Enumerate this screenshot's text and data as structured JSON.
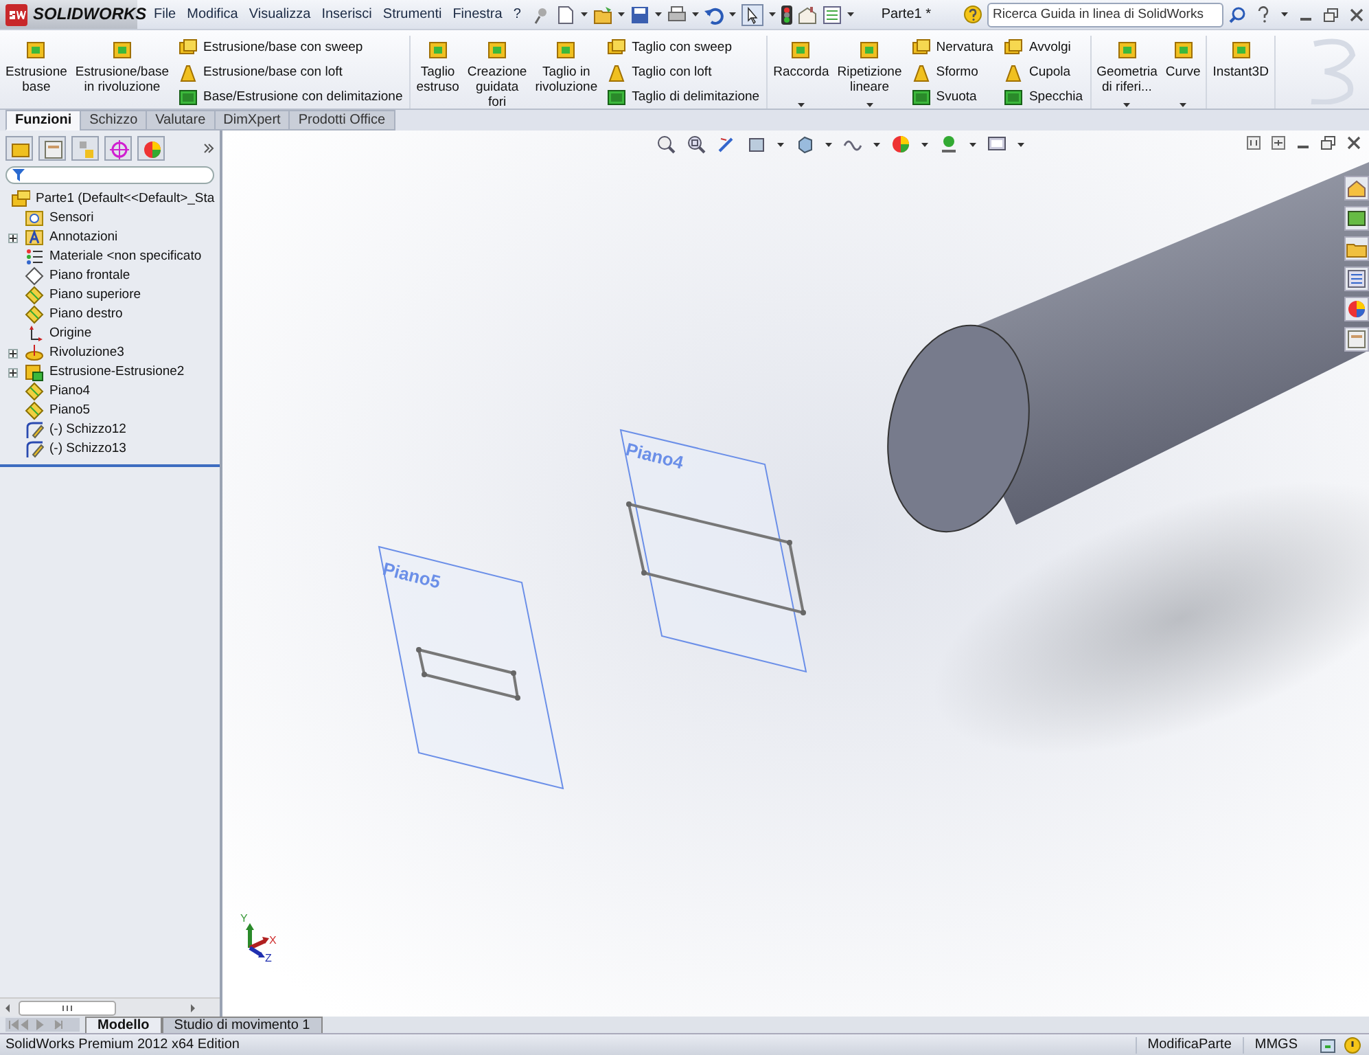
{
  "app": {
    "logo": "SOLIDWORKS",
    "document_title": "Parte1 *"
  },
  "menu": [
    "File",
    "Modifica",
    "Visualizza",
    "Inserisci",
    "Strumenti",
    "Finestra",
    "?"
  ],
  "search": {
    "placeholder": "Ricerca Guida in linea di SolidWorks"
  },
  "ribbon": {
    "groups": [
      {
        "columns": [
          {
            "kind": "large",
            "lines": [
              "Estrusione",
              "base"
            ],
            "dropdown": false
          },
          {
            "kind": "large",
            "lines": [
              "Estrusione/base",
              "in rivoluzione"
            ],
            "dropdown": false
          },
          {
            "kind": "stack",
            "items": [
              "Estrusione/base con sweep",
              "Estrusione/base con loft",
              "Base/Estrusione con delimitazione"
            ]
          }
        ]
      },
      {
        "columns": [
          {
            "kind": "large",
            "lines": [
              "Taglio",
              "estruso"
            ],
            "dropdown": false
          },
          {
            "kind": "large",
            "lines": [
              "Creazione",
              "guidata",
              "fori"
            ],
            "dropdown": false
          },
          {
            "kind": "large",
            "lines": [
              "Taglio in",
              "rivoluzione"
            ],
            "dropdown": false
          },
          {
            "kind": "stack",
            "items": [
              "Taglio con sweep",
              "Taglio con loft",
              "Taglio di delimitazione"
            ]
          }
        ]
      },
      {
        "columns": [
          {
            "kind": "large",
            "lines": [
              "Raccorda"
            ],
            "dropdown": true
          },
          {
            "kind": "large",
            "lines": [
              "Ripetizione",
              "lineare"
            ],
            "dropdown": true
          },
          {
            "kind": "stack",
            "items": [
              "Nervatura",
              "Sformo",
              "Svuota"
            ]
          },
          {
            "kind": "stack",
            "items": [
              "Avvolgi",
              "Cupola",
              "Specchia"
            ]
          }
        ]
      },
      {
        "columns": [
          {
            "kind": "large",
            "lines": [
              "Geometria",
              "di riferi..."
            ],
            "dropdown": true
          },
          {
            "kind": "large",
            "lines": [
              "Curve"
            ],
            "dropdown": true
          }
        ]
      },
      {
        "columns": [
          {
            "kind": "large",
            "lines": [
              "Instant3D"
            ],
            "dropdown": false
          }
        ]
      }
    ]
  },
  "command_tabs": [
    {
      "label": "Funzioni",
      "selected": true
    },
    {
      "label": "Schizzo",
      "selected": false
    },
    {
      "label": "Valutare",
      "selected": false
    },
    {
      "label": "DimXpert",
      "selected": false
    },
    {
      "label": "Prodotti Office",
      "selected": false
    }
  ],
  "feature_tree": {
    "root": {
      "label": "Parte1  (Default<<Default>_Sta",
      "kind": "part",
      "children": [
        {
          "label": "Sensori",
          "kind": "sensor"
        },
        {
          "label": "Annotazioni",
          "kind": "annotation",
          "expanded": false
        },
        {
          "label": "Materiale <non specificato",
          "kind": "material"
        },
        {
          "label": "Piano frontale",
          "kind": "plane-outline"
        },
        {
          "label": "Piano superiore",
          "kind": "plane"
        },
        {
          "label": "Piano destro",
          "kind": "plane"
        },
        {
          "label": "Origine",
          "kind": "origin"
        },
        {
          "label": "Rivoluzione3",
          "kind": "revolve",
          "expanded": false
        },
        {
          "label": "Estrusione-Estrusione2",
          "kind": "extrude",
          "expanded": false
        },
        {
          "label": "Piano4",
          "kind": "plane"
        },
        {
          "label": "Piano5",
          "kind": "plane"
        },
        {
          "label": "(-) Schizzo12",
          "kind": "sketch"
        },
        {
          "label": "(-) Schizzo13",
          "kind": "sketch"
        }
      ]
    }
  },
  "viewport": {
    "planes": [
      {
        "label": "Piano5"
      },
      {
        "label": "Piano4"
      }
    ],
    "triad": {
      "x": "X",
      "y": "Y",
      "z": "Z"
    }
  },
  "bottom_tabs": [
    {
      "label": "Modello",
      "selected": true
    },
    {
      "label": "Studio di movimento 1",
      "selected": false
    }
  ],
  "status_bar": {
    "edition": "SolidWorks Premium 2012 x64 Edition",
    "mode": "ModificaParte",
    "units": "MMGS"
  }
}
